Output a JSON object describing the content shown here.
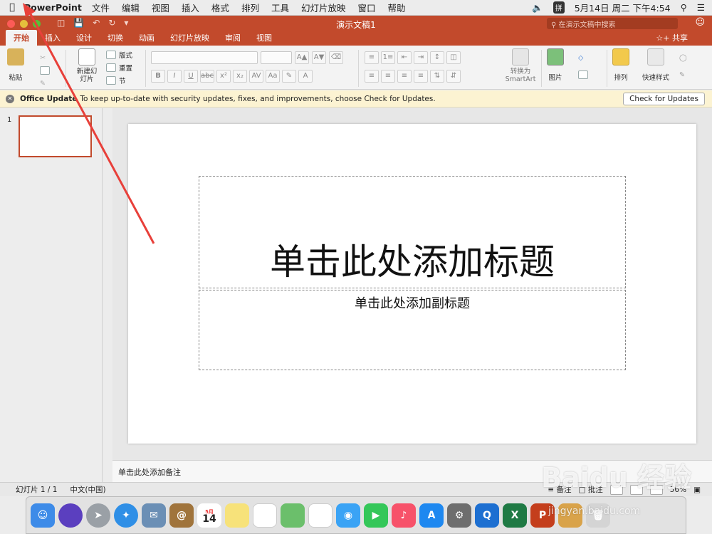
{
  "menubar": {
    "app_name": "PowerPoint",
    "items": [
      "文件",
      "编辑",
      "视图",
      "插入",
      "格式",
      "排列",
      "工具",
      "幻灯片放映",
      "窗口",
      "帮助"
    ],
    "ime": "拼",
    "clock": "5月14日 周二 下午4:54"
  },
  "window": {
    "title": "演示文稿1",
    "search_placeholder": "在演示文稿中搜索",
    "accent_color": "#c24a2c"
  },
  "ribbon": {
    "tabs": [
      "开始",
      "插入",
      "设计",
      "切换",
      "动画",
      "幻灯片放映",
      "审阅",
      "视图"
    ],
    "active_tab": "开始",
    "share_label": "共享",
    "paste_label": "粘贴",
    "new_slide_label": "新建幻灯片",
    "layout_label": "版式",
    "reset_label": "重置",
    "section_label": "节",
    "smartart_label": "转换为 SmartArt",
    "picture_label": "图片",
    "arrange_label": "排列",
    "quick_styles_label": "快速样式"
  },
  "update_bar": {
    "title": "Office Update",
    "message": "To keep up-to-date with security updates, fixes, and improvements, choose Check for Updates.",
    "button": "Check for Updates"
  },
  "slide_pane": {
    "slide_number": "1"
  },
  "slide": {
    "title_placeholder": "单击此处添加标题",
    "subtitle_placeholder": "单击此处添加副标题"
  },
  "notes": {
    "placeholder": "单击此处添加备注"
  },
  "statusbar": {
    "slide_count": "幻灯片 1 / 1",
    "language": "中文(中国)",
    "notes_label": "备注",
    "comments_label": "批注",
    "zoom": "56%"
  },
  "dock": {
    "calendar_day": "14",
    "calendar_month": "5月"
  },
  "watermark": {
    "brand": "Baidu 经验",
    "url": "jingyan.baidu.com"
  }
}
